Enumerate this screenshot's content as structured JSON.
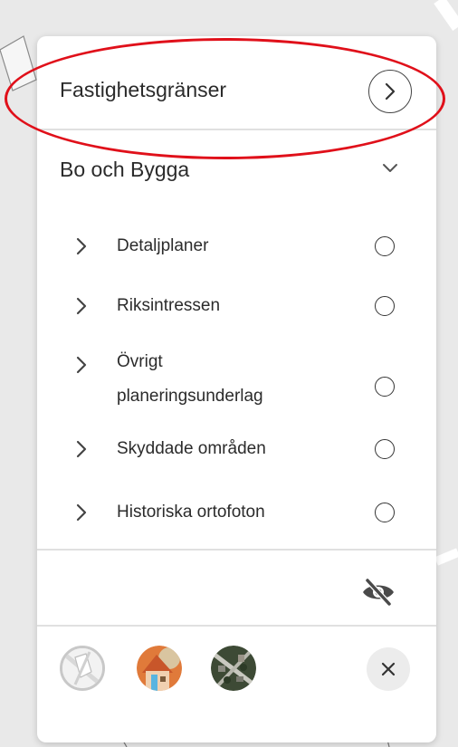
{
  "panel": {
    "top_item": {
      "label": "Fastighetsgränser",
      "icon": "chevron-right-circle-icon"
    },
    "section": {
      "title": "Bo och Bygga",
      "icon": "chevron-down-icon"
    },
    "layers": [
      {
        "label": "Detaljplaner"
      },
      {
        "label": "Riksintressen"
      },
      {
        "label_line1": "Övrigt",
        "label_line2": "planeringsunderlag"
      },
      {
        "label": "Skyddade områden"
      },
      {
        "label": "Historiska ortofoton"
      }
    ],
    "footer": {
      "visibility_icon": "eye-off-icon",
      "basemaps": [
        "map-basemap-icon",
        "illustrated-basemap-icon",
        "aerial-basemap-icon"
      ],
      "close_icon": "close-icon"
    }
  },
  "colors": {
    "highlight": "#e0101a",
    "panel_bg": "#ffffff",
    "map_bg": "#e9e9e9"
  }
}
